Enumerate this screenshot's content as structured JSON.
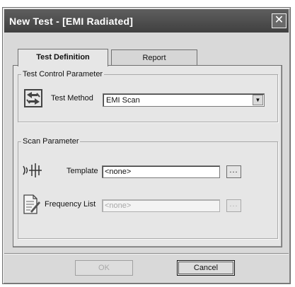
{
  "window": {
    "title": "New Test - [EMI Radiated]",
    "close_glyph": "✕"
  },
  "tabs": [
    {
      "label": "Test Definition",
      "active": true
    },
    {
      "label": "Report",
      "active": false
    }
  ],
  "test_control": {
    "legend": "Test Control Parameter",
    "method_label": "Test Method",
    "method_value": "EMI Scan",
    "method_icon": "recycle-arrows-icon"
  },
  "scan": {
    "legend": "Scan Parameter",
    "template_label": "Template",
    "template_value": "<none>",
    "template_icon": "antenna-signal-icon",
    "freq_label": "Frequency List",
    "freq_value": "<none>",
    "freq_icon": "document-pen-icon",
    "browse_label": "..."
  },
  "buttons": {
    "ok_label": "OK",
    "cancel_label": "Cancel"
  },
  "colors": {
    "titlebar": "#4e4e4e",
    "face": "#d9d9d9",
    "panel": "#e6e6e6"
  }
}
